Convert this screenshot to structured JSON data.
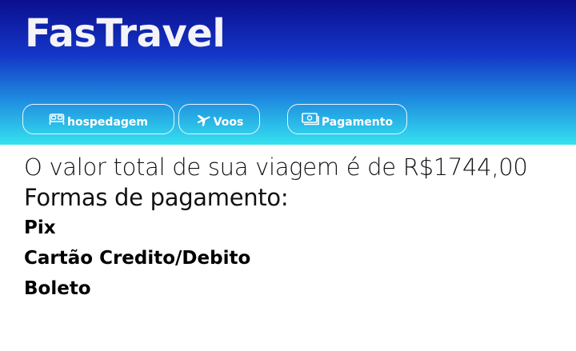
{
  "header": {
    "brand": "FasTravel",
    "nav": [
      {
        "label": "hospedagem",
        "icon": "bed-icon"
      },
      {
        "label": "Voos",
        "icon": "plane-icon"
      },
      {
        "label": "Pagamento",
        "icon": "money-icon"
      }
    ]
  },
  "main": {
    "total_text": "O valor total de sua viagem é de R$1744,00",
    "forms_title": "Formas de pagamento:",
    "options": [
      "Pix",
      "Cartão Credito/Debito",
      "Boleto"
    ]
  },
  "colors": {
    "header_top": "#0b0f8e",
    "header_bottom": "#35e2ef",
    "text": "#000000"
  }
}
